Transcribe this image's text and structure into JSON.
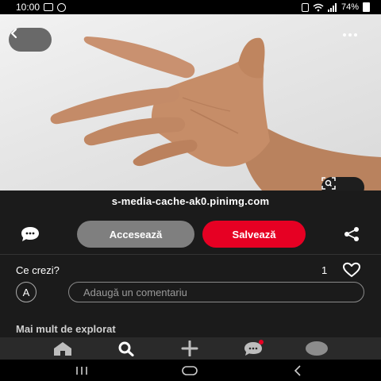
{
  "status_bar": {
    "time": "10:00",
    "battery": "74%",
    "icons": [
      "gallery-icon",
      "whatsapp-icon",
      "sim-icon",
      "wifi-icon",
      "signal-icon",
      "battery-icon"
    ]
  },
  "pin": {
    "image_subject": "hand",
    "source": "s-media-cache-ak0.pinimg.com"
  },
  "actions": {
    "visit_label": "Accesează",
    "save_label": "Salvează",
    "visit_color": "#7f7f7f",
    "save_color": "#e60023"
  },
  "comments": {
    "heading": "Ce crezi?",
    "like_count": "1",
    "avatar_initial": "A",
    "placeholder": "Adaugă un comentariu"
  },
  "explore": {
    "heading": "Mai mult de explorat"
  },
  "tabs": [
    {
      "name": "home-icon"
    },
    {
      "name": "search-icon"
    },
    {
      "name": "plus-icon"
    },
    {
      "name": "messages-icon",
      "badge": true
    },
    {
      "name": "profile-icon"
    }
  ],
  "system_nav": [
    "recents-icon",
    "home-circle-icon",
    "back-arrow-icon"
  ]
}
